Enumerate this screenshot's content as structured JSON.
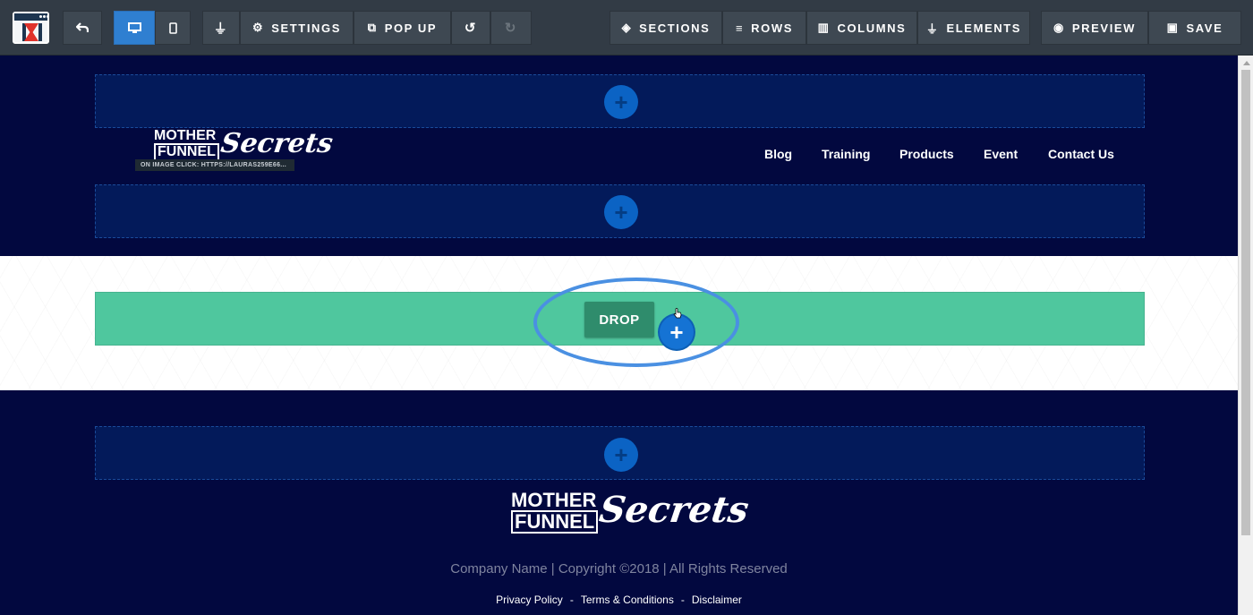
{
  "toolbar": {
    "logo_icon": "clickfunnels-logo",
    "back_icon": "undo-arrow-icon",
    "desktop_icon": "desktop-icon",
    "mobile_icon": "mobile-icon",
    "plugin_icon": "plug-icon",
    "settings_label": "SETTINGS",
    "popup_label": "POP UP",
    "undo_icon": "undo-icon",
    "redo_icon": "redo-icon",
    "sections_label": "SECTIONS",
    "rows_label": "ROWS",
    "columns_label": "COLUMNS",
    "elements_label": "ELEMENTS",
    "preview_label": "PREVIEW",
    "save_label": "SAVE",
    "active_color": "#2f7fd1"
  },
  "header": {
    "logo_top": "MOTHER",
    "logo_bottom": "FUNNEL",
    "logo_script": "Secrets",
    "image_tooltip": "ON IMAGE CLICK: HTTPS://LAURAS259E66...",
    "nav": [
      "Blog",
      "Training",
      "Products",
      "Event",
      "Contact Us"
    ]
  },
  "main": {
    "drop_label": "DROP",
    "drop_color": "#4fc79e"
  },
  "footer": {
    "logo_top": "MOTHER",
    "logo_bottom": "FUNNEL",
    "logo_script": "Secrets",
    "copyright": "Company Name | Copyright ©2018 | All Rights Reserved",
    "links": [
      "Privacy Policy",
      "Terms & Conditions",
      "Disclaimer"
    ],
    "separator": "-"
  }
}
